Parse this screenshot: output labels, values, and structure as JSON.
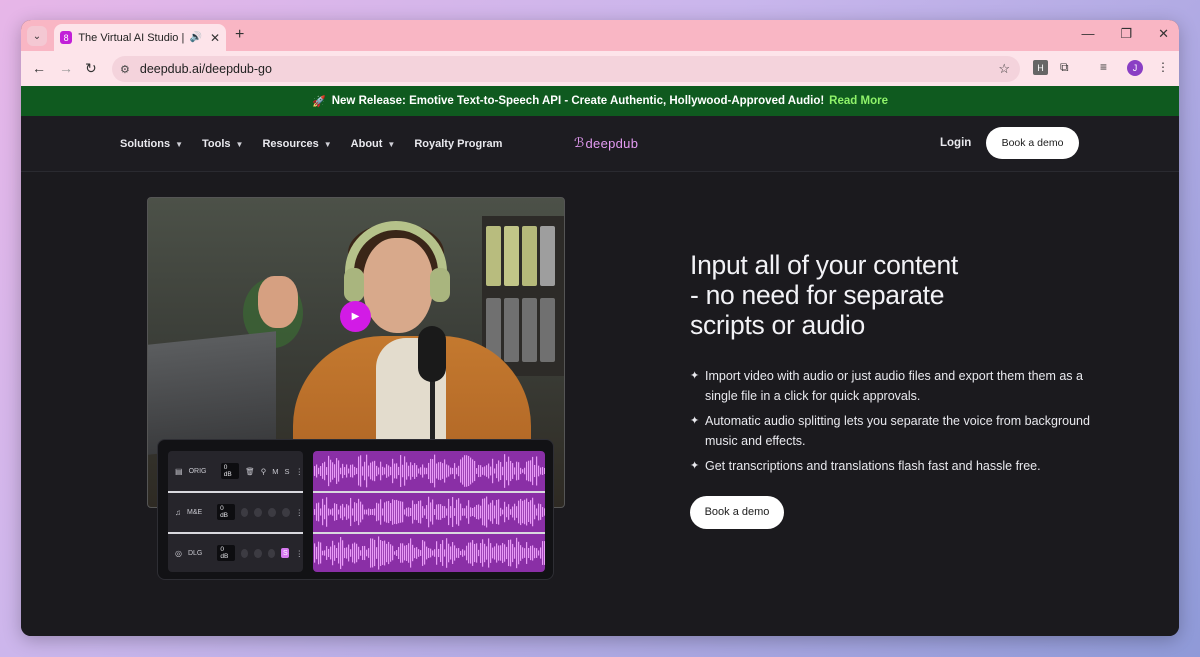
{
  "browser": {
    "tab_title": "The Virtual AI Studio | Deep",
    "tab_favicon": "8",
    "new_tab": "+",
    "url": "deepdub.ai/deepdub-go",
    "profile_initial": "J",
    "extension_label": "H"
  },
  "announcement": {
    "icon": "🚀",
    "text": "New Release: Emotive Text-to-Speech API - Create Authentic, Hollywood-Approved Audio!",
    "link": "Read More"
  },
  "nav": {
    "items": [
      {
        "label": "Solutions"
      },
      {
        "label": "Tools"
      },
      {
        "label": "Resources"
      },
      {
        "label": "About"
      },
      {
        "label": "Royalty Program"
      }
    ],
    "logo": "deepdub",
    "login": "Login",
    "cta": "Book a demo"
  },
  "editor": {
    "tracks": [
      {
        "label": "ORIG",
        "gain": "0 dB"
      },
      {
        "label": "M&E",
        "gain": "0 dB"
      },
      {
        "label": "DLG",
        "gain": "0 dB"
      }
    ],
    "mute": "M",
    "solo": "S"
  },
  "hero": {
    "headline_line1": "Input all of your content",
    "headline_line2": "- no need for separate",
    "headline_line3": "scripts or audio",
    "features": [
      "Import video with audio or just audio files and export them  them as a single file in a click for quick approvals.",
      "Automatic audio splitting lets you separate the voice from background music and effects.",
      "Get transcriptions and translations flash fast and hassle free."
    ],
    "cta": "Book a demo"
  },
  "colors": {
    "announcement_bg": "#0f5a1f",
    "read_more": "#8ff36a",
    "logo": "#e49bf3",
    "play_button": "#d21be6",
    "waveform_bg": "#8a2fa6",
    "page_bg": "#1b1a1e"
  }
}
